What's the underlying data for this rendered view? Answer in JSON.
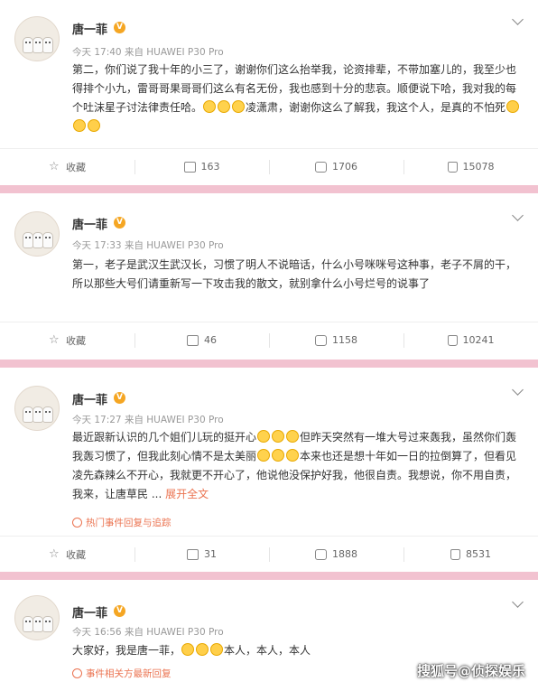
{
  "posts": [
    {
      "name": "唐一菲",
      "time": "今天 17:40",
      "source": "来自 HUAWEI P30 Pro",
      "text_parts": [
        "第二，你们说了我十年的小三了，谢谢你们这么抬举我，论资排辈，不带加塞儿的，我至少也得排个小九，雷哥哥果哥哥们这么有名无份，我也感到十分的悲哀。顺便说下哈，我对我的每个吐沫星子讨法律责任哈。",
        "凌潇肃，谢谢你这么了解我，我这个人，是真的不怕死"
      ],
      "fav": "收藏",
      "share": "163",
      "comment": "1706",
      "like": "15078"
    },
    {
      "name": "唐一菲",
      "time": "今天 17:33",
      "source": "来自 HUAWEI P30 Pro",
      "text_parts": [
        "第一，老子是武汉生武汉长，习惯了明人不说暗话，什么小号咪咪号这种事，老子不屑的干，所以那些大号们请重新写一下攻击我的散文，就别拿什么小号烂号的说事了"
      ],
      "fav": "收藏",
      "share": "46",
      "comment": "1158",
      "like": "10241"
    },
    {
      "name": "唐一菲",
      "time": "今天 17:27",
      "source": "来自 HUAWEI P30 Pro",
      "text_parts": [
        "最近跟新认识的几个姐们儿玩的挺开心",
        "但昨天突然有一堆大号过来轰我，虽然你们轰我轰习惯了，但我此刻心情不是太美丽",
        "本来也还是想十年如一日的拉倒算了，但看见凌先森辣么不开心，我就更不开心了，他说他没保护好我，他很自责。我想说，你不用自责，我来，让唐草民 ... "
      ],
      "more": "展开全文",
      "tag": "热门事件回复与追踪",
      "fav": "收藏",
      "share": "31",
      "comment": "1888",
      "like": "8531"
    },
    {
      "name": "唐一菲",
      "time": "今天 16:56",
      "source": "来自 HUAWEI P30 Pro",
      "text_parts": [
        "大家好，我是唐一菲，",
        "本人，本人，本人"
      ],
      "tag": "事件相关方最新回复"
    }
  ],
  "watermark": "搜狐号@侦探娱乐",
  "colors": {
    "accent": "#eb7350",
    "separator": "#f2c2d0",
    "verified": "#f5a623"
  }
}
